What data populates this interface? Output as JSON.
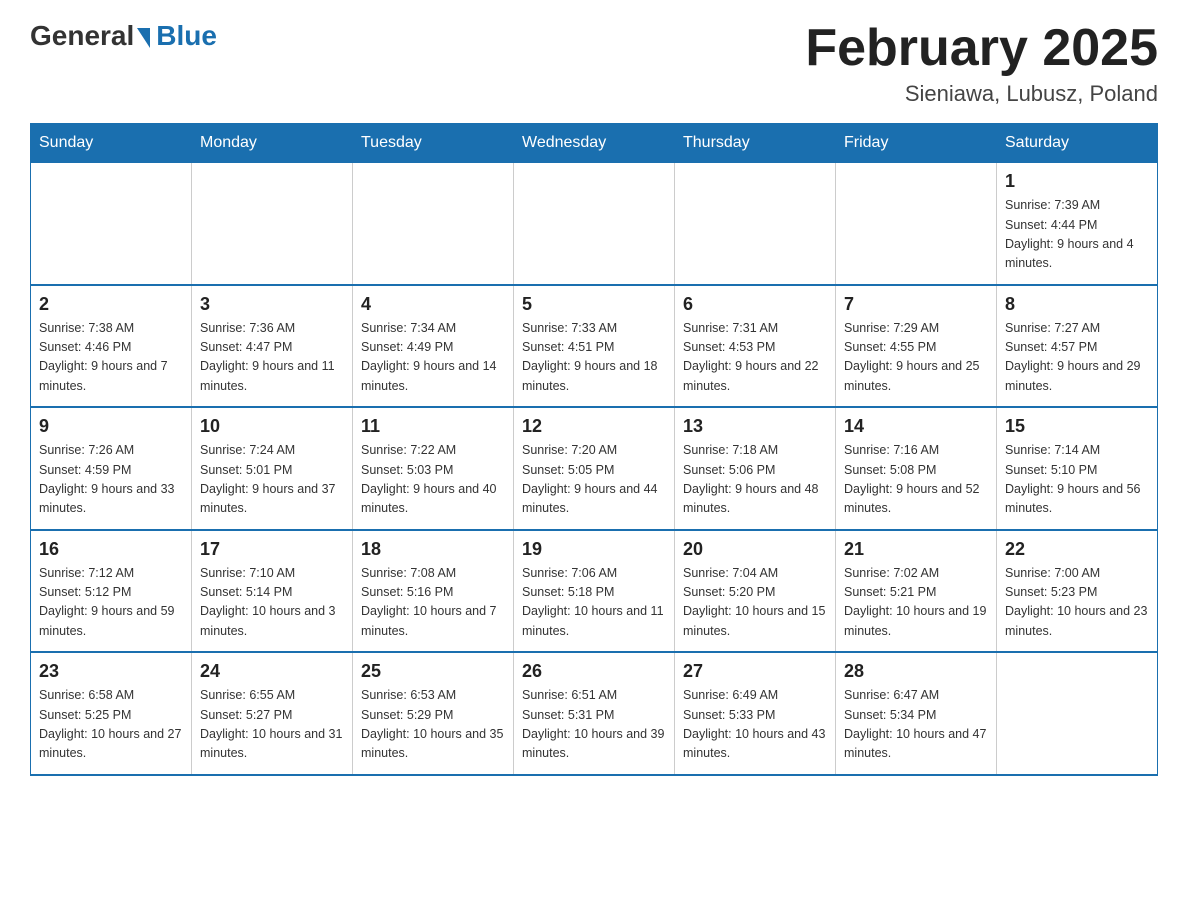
{
  "header": {
    "title": "February 2025",
    "subtitle": "Sieniawa, Lubusz, Poland",
    "logo_general": "General",
    "logo_blue": "Blue"
  },
  "days_of_week": [
    "Sunday",
    "Monday",
    "Tuesday",
    "Wednesday",
    "Thursday",
    "Friday",
    "Saturday"
  ],
  "weeks": [
    {
      "days": [
        {
          "number": "",
          "info": ""
        },
        {
          "number": "",
          "info": ""
        },
        {
          "number": "",
          "info": ""
        },
        {
          "number": "",
          "info": ""
        },
        {
          "number": "",
          "info": ""
        },
        {
          "number": "",
          "info": ""
        },
        {
          "number": "1",
          "info": "Sunrise: 7:39 AM\nSunset: 4:44 PM\nDaylight: 9 hours and 4 minutes."
        }
      ]
    },
    {
      "days": [
        {
          "number": "2",
          "info": "Sunrise: 7:38 AM\nSunset: 4:46 PM\nDaylight: 9 hours and 7 minutes."
        },
        {
          "number": "3",
          "info": "Sunrise: 7:36 AM\nSunset: 4:47 PM\nDaylight: 9 hours and 11 minutes."
        },
        {
          "number": "4",
          "info": "Sunrise: 7:34 AM\nSunset: 4:49 PM\nDaylight: 9 hours and 14 minutes."
        },
        {
          "number": "5",
          "info": "Sunrise: 7:33 AM\nSunset: 4:51 PM\nDaylight: 9 hours and 18 minutes."
        },
        {
          "number": "6",
          "info": "Sunrise: 7:31 AM\nSunset: 4:53 PM\nDaylight: 9 hours and 22 minutes."
        },
        {
          "number": "7",
          "info": "Sunrise: 7:29 AM\nSunset: 4:55 PM\nDaylight: 9 hours and 25 minutes."
        },
        {
          "number": "8",
          "info": "Sunrise: 7:27 AM\nSunset: 4:57 PM\nDaylight: 9 hours and 29 minutes."
        }
      ]
    },
    {
      "days": [
        {
          "number": "9",
          "info": "Sunrise: 7:26 AM\nSunset: 4:59 PM\nDaylight: 9 hours and 33 minutes."
        },
        {
          "number": "10",
          "info": "Sunrise: 7:24 AM\nSunset: 5:01 PM\nDaylight: 9 hours and 37 minutes."
        },
        {
          "number": "11",
          "info": "Sunrise: 7:22 AM\nSunset: 5:03 PM\nDaylight: 9 hours and 40 minutes."
        },
        {
          "number": "12",
          "info": "Sunrise: 7:20 AM\nSunset: 5:05 PM\nDaylight: 9 hours and 44 minutes."
        },
        {
          "number": "13",
          "info": "Sunrise: 7:18 AM\nSunset: 5:06 PM\nDaylight: 9 hours and 48 minutes."
        },
        {
          "number": "14",
          "info": "Sunrise: 7:16 AM\nSunset: 5:08 PM\nDaylight: 9 hours and 52 minutes."
        },
        {
          "number": "15",
          "info": "Sunrise: 7:14 AM\nSunset: 5:10 PM\nDaylight: 9 hours and 56 minutes."
        }
      ]
    },
    {
      "days": [
        {
          "number": "16",
          "info": "Sunrise: 7:12 AM\nSunset: 5:12 PM\nDaylight: 9 hours and 59 minutes."
        },
        {
          "number": "17",
          "info": "Sunrise: 7:10 AM\nSunset: 5:14 PM\nDaylight: 10 hours and 3 minutes."
        },
        {
          "number": "18",
          "info": "Sunrise: 7:08 AM\nSunset: 5:16 PM\nDaylight: 10 hours and 7 minutes."
        },
        {
          "number": "19",
          "info": "Sunrise: 7:06 AM\nSunset: 5:18 PM\nDaylight: 10 hours and 11 minutes."
        },
        {
          "number": "20",
          "info": "Sunrise: 7:04 AM\nSunset: 5:20 PM\nDaylight: 10 hours and 15 minutes."
        },
        {
          "number": "21",
          "info": "Sunrise: 7:02 AM\nSunset: 5:21 PM\nDaylight: 10 hours and 19 minutes."
        },
        {
          "number": "22",
          "info": "Sunrise: 7:00 AM\nSunset: 5:23 PM\nDaylight: 10 hours and 23 minutes."
        }
      ]
    },
    {
      "days": [
        {
          "number": "23",
          "info": "Sunrise: 6:58 AM\nSunset: 5:25 PM\nDaylight: 10 hours and 27 minutes."
        },
        {
          "number": "24",
          "info": "Sunrise: 6:55 AM\nSunset: 5:27 PM\nDaylight: 10 hours and 31 minutes."
        },
        {
          "number": "25",
          "info": "Sunrise: 6:53 AM\nSunset: 5:29 PM\nDaylight: 10 hours and 35 minutes."
        },
        {
          "number": "26",
          "info": "Sunrise: 6:51 AM\nSunset: 5:31 PM\nDaylight: 10 hours and 39 minutes."
        },
        {
          "number": "27",
          "info": "Sunrise: 6:49 AM\nSunset: 5:33 PM\nDaylight: 10 hours and 43 minutes."
        },
        {
          "number": "28",
          "info": "Sunrise: 6:47 AM\nSunset: 5:34 PM\nDaylight: 10 hours and 47 minutes."
        },
        {
          "number": "",
          "info": ""
        }
      ]
    }
  ]
}
